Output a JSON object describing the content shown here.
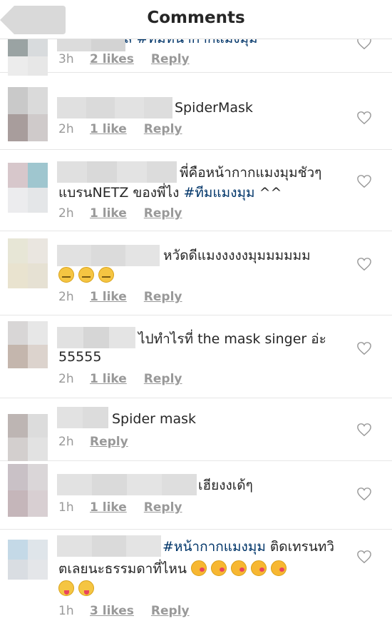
{
  "header": {
    "title": "Comments"
  },
  "comments": [
    {
      "text_parts": [
        {
          "t": "ส #ทีมหน้ากากแมงมุม",
          "tag": true
        }
      ],
      "time": "3h",
      "likes": "2 likes",
      "reply": "Reply"
    },
    {
      "text_parts": [
        {
          "t": "SpiderMask",
          "tag": false
        }
      ],
      "time": "2h",
      "likes": "1 like",
      "reply": "Reply"
    },
    {
      "line1": "พี่คือหน้ากากแมงมุมชัวๆ",
      "line2_pre": "แบรนNETZ ของพี่ไง ",
      "line2_tag": "#ทีมแมงมุม",
      "line2_post": " ^^",
      "time": "2h",
      "likes": "1 like",
      "reply": "Reply"
    },
    {
      "line1": "หวัดดีแมงงงงงมุมมมมมม",
      "emojis": [
        "zip",
        "zip",
        "zip"
      ],
      "time": "2h",
      "likes": "1 like",
      "reply": "Reply"
    },
    {
      "line1": "ไปทำไรที่ the mask singer อ่ะ",
      "line2": "55555",
      "time": "2h",
      "likes": "1 like",
      "reply": "Reply"
    },
    {
      "line1": "Spider mask",
      "time": "2h",
      "reply": "Reply"
    },
    {
      "line1": "เฮียงงเด้ๆ",
      "time": "1h",
      "likes": "1 like",
      "reply": "Reply"
    },
    {
      "line1_tag": "#หน้ากากแมงมุม",
      "line1_post": " ติดเทรนทวิ",
      "line2": "ตเลยนะธรรมดาที่ไหน ",
      "emojis_line2": [
        "kiss",
        "kiss",
        "kiss",
        "kiss",
        "kiss"
      ],
      "emojis_line3": [
        "tongue",
        "tongue"
      ],
      "time": "1h",
      "likes": "3 likes",
      "reply": "Reply"
    }
  ],
  "colors": {
    "text": "#262626",
    "meta": "#999999",
    "hashtag": "#003569",
    "divider": "#e6e6e6"
  },
  "icons": {
    "back": "back-arrow-icon",
    "like": "heart-outline-icon"
  }
}
